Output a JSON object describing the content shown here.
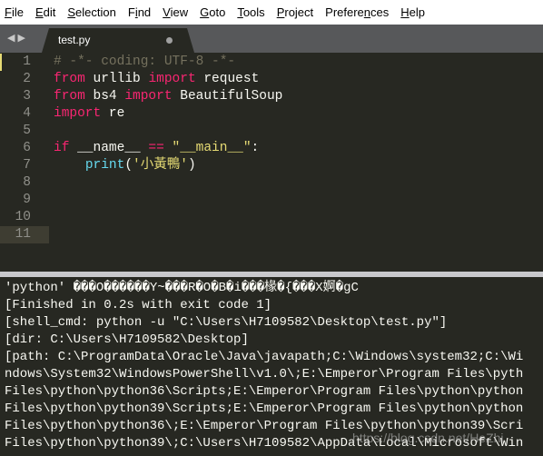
{
  "menu": [
    {
      "pre": "",
      "u": "F",
      "post": "ile"
    },
    {
      "pre": "",
      "u": "E",
      "post": "dit"
    },
    {
      "pre": "",
      "u": "S",
      "post": "election"
    },
    {
      "pre": "F",
      "u": "i",
      "post": "nd"
    },
    {
      "pre": "",
      "u": "V",
      "post": "iew"
    },
    {
      "pre": "",
      "u": "G",
      "post": "oto"
    },
    {
      "pre": "",
      "u": "T",
      "post": "ools"
    },
    {
      "pre": "",
      "u": "P",
      "post": "roject"
    },
    {
      "pre": "Prefere",
      "u": "n",
      "post": "ces"
    },
    {
      "pre": "",
      "u": "H",
      "post": "elp"
    }
  ],
  "tab": {
    "nav": "◀▶",
    "label": "test.py",
    "modified": true
  },
  "editor": {
    "line_numbers": [
      "1",
      "2",
      "3",
      "4",
      "5",
      "6",
      "7",
      "8",
      "9",
      "10",
      "11"
    ],
    "current_line": "11",
    "lines": [
      [
        {
          "t": "# -*- coding: UTF-8 -*-",
          "c": "cm"
        }
      ],
      [
        {
          "t": "from",
          "c": "kw"
        },
        {
          "t": " urllib ",
          "c": ""
        },
        {
          "t": "import",
          "c": "kw"
        },
        {
          "t": " request",
          "c": ""
        }
      ],
      [
        {
          "t": "from",
          "c": "kw"
        },
        {
          "t": " bs4 ",
          "c": ""
        },
        {
          "t": "import",
          "c": "kw"
        },
        {
          "t": " BeautifulSoup",
          "c": ""
        }
      ],
      [
        {
          "t": "import",
          "c": "kw"
        },
        {
          "t": " re",
          "c": ""
        }
      ],
      [],
      [
        {
          "t": "if",
          "c": "kw"
        },
        {
          "t": " __name__ ",
          "c": ""
        },
        {
          "t": "==",
          "c": "kw"
        },
        {
          "t": " ",
          "c": ""
        },
        {
          "t": "\"__main__\"",
          "c": "st"
        },
        {
          "t": ":",
          "c": ""
        }
      ],
      [
        {
          "t": "    ",
          "c": ""
        },
        {
          "t": "print",
          "c": "fn"
        },
        {
          "t": "(",
          "c": ""
        },
        {
          "t": "'小黃鴨'",
          "c": "st"
        },
        {
          "t": ")",
          "c": ""
        }
      ],
      [],
      [],
      [],
      []
    ]
  },
  "output": {
    "lines": [
      "'python' ���O������Y~���R�O�B�i���椽�{���X婀�gC",
      "[Finished in 0.2s with exit code 1]",
      "[shell_cmd: python -u \"C:\\Users\\H7109582\\Desktop\\test.py\"]",
      "[dir: C:\\Users\\H7109582\\Desktop]",
      "[path: C:\\ProgramData\\Oracle\\Java\\javapath;C:\\Windows\\system32;C:\\Wi",
      "ndows\\System32\\WindowsPowerShell\\v1.0\\;E:\\Emperor\\Program Files\\pyth",
      "Files\\python\\python36\\Scripts;E:\\Emperor\\Program Files\\python\\python",
      "Files\\python\\python39\\Scripts;E:\\Emperor\\Program Files\\python\\python",
      "Files\\python\\python36\\;E:\\Emperor\\Program Files\\python\\python39\\Scri",
      "Files\\python\\python39\\;C:\\Users\\H7109582\\AppData\\Local\\Microsoft\\Win"
    ]
  },
  "watermark": "https://blog.csdn.net/HeZhi",
  "colors": {
    "background": "#272822",
    "keyword": "#f92672",
    "comment": "#75715e",
    "string": "#e6db74",
    "function": "#66d9ef"
  }
}
